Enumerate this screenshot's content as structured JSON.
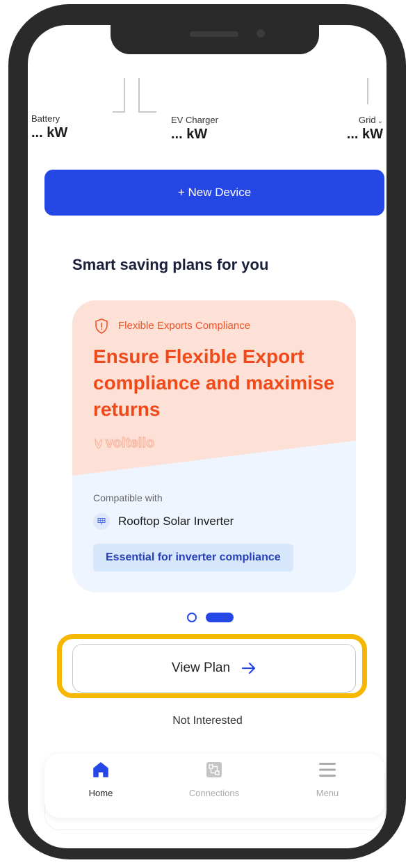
{
  "metrics": {
    "battery": {
      "label": "Battery",
      "value": "... kW"
    },
    "ev_charger": {
      "label": "EV Charger",
      "value": "... kW"
    },
    "grid": {
      "label": "Grid",
      "value": "... kW"
    }
  },
  "new_device_button": "+ New Device",
  "section_title": "Smart saving plans for you",
  "plan_card": {
    "category": "Flexible Exports Compliance",
    "headline": "Ensure Flexible Export compliance and maximise returns",
    "brand": "voltello",
    "compatible_label": "Compatible with",
    "compatible_item": "Rooftop Solar Inverter",
    "badge": "Essential for inverter compliance"
  },
  "pager": {
    "total": 2,
    "active": 2
  },
  "view_plan_button": "View Plan",
  "not_interested": "Not Interested",
  "bottom_nav": [
    {
      "label": "Home",
      "icon": "home-icon",
      "active": true
    },
    {
      "label": "Connections",
      "icon": "connections-icon",
      "active": false
    },
    {
      "label": "Menu",
      "icon": "menu-icon",
      "active": false
    }
  ],
  "colors": {
    "primary": "#2547e5",
    "accent_orange": "#f04a1a",
    "highlight": "#f5b700",
    "card_top": "#fde0d6",
    "card_bottom": "#eef5ff",
    "frame": "#2a2a2a"
  }
}
